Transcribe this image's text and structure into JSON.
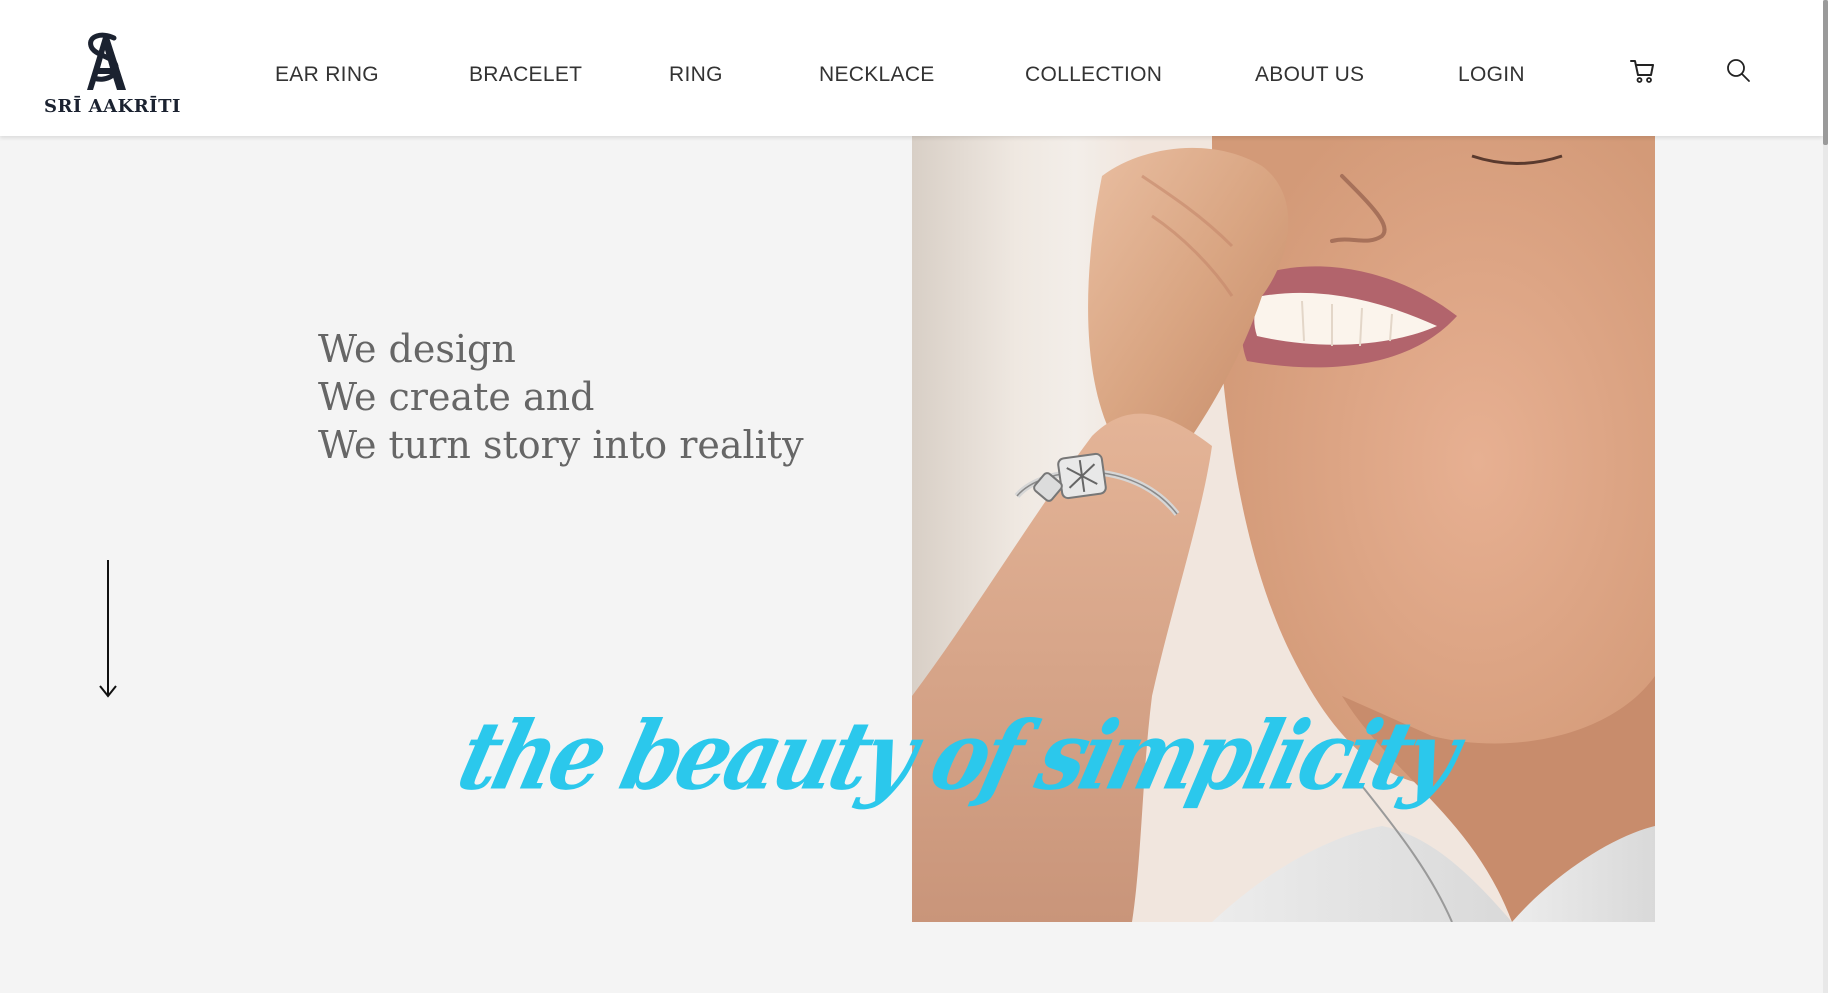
{
  "brand": {
    "name": "SRĪ AAKRĪTI",
    "monogram": "SA",
    "color": "#1b2230"
  },
  "nav": {
    "items": [
      {
        "id": "ear-ring",
        "label": "EAR RING"
      },
      {
        "id": "bracelet",
        "label": "BRACELET"
      },
      {
        "id": "ring",
        "label": "RING"
      },
      {
        "id": "necklace",
        "label": "NECKLACE"
      },
      {
        "id": "collection",
        "label": "COLLECTION"
      },
      {
        "id": "about-us",
        "label": "ABOUT US"
      },
      {
        "id": "login",
        "label": "LOGIN"
      }
    ],
    "icons": [
      "cart-icon",
      "search-icon"
    ]
  },
  "hero": {
    "tagline": [
      "We design",
      "We create and",
      "We turn story into reality"
    ],
    "script": "the beauty of simplicity",
    "script_color": "#2bc8ec",
    "text_color": "#666666",
    "background": "#f4f4f4"
  }
}
